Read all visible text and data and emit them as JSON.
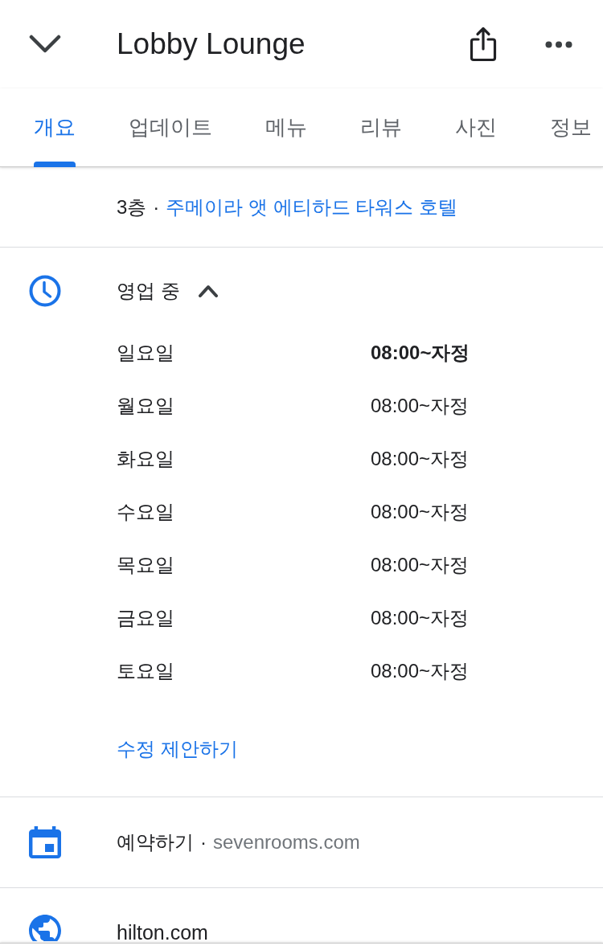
{
  "header": {
    "title": "Lobby Lounge"
  },
  "tabs": [
    {
      "label": "개요",
      "selected": true
    },
    {
      "label": "업데이트",
      "selected": false
    },
    {
      "label": "메뉴",
      "selected": false
    },
    {
      "label": "리뷰",
      "selected": false
    },
    {
      "label": "사진",
      "selected": false
    },
    {
      "label": "정보",
      "selected": false
    }
  ],
  "location": {
    "floor": "3층",
    "separator": "·",
    "hotel": "주메이라 앳 에티하드 타워스 호텔"
  },
  "hours": {
    "status": "영업 중",
    "expanded": true,
    "days": [
      {
        "day": "일요일",
        "hours": "08:00~자정",
        "today": true
      },
      {
        "day": "월요일",
        "hours": "08:00~자정",
        "today": false
      },
      {
        "day": "화요일",
        "hours": "08:00~자정",
        "today": false
      },
      {
        "day": "수요일",
        "hours": "08:00~자정",
        "today": false
      },
      {
        "day": "목요일",
        "hours": "08:00~자정",
        "today": false
      },
      {
        "day": "금요일",
        "hours": "08:00~자정",
        "today": false
      },
      {
        "day": "토요일",
        "hours": "08:00~자정",
        "today": false
      }
    ],
    "suggest_edit": "수정 제안하기"
  },
  "reservation": {
    "label": "예약하기",
    "separator": "·",
    "site": "sevenrooms.com"
  },
  "website": {
    "url": "hilton.com"
  }
}
